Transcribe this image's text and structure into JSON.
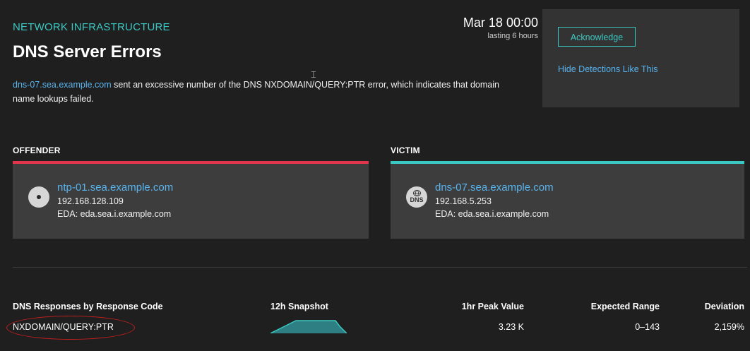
{
  "detection": {
    "category": "NETWORK INFRASTRUCTURE",
    "title": "DNS Server Errors",
    "description_link": "dns-07.sea.example.com",
    "description_text": " sent an excessive number of the DNS NXDOMAIN/QUERY:PTR error, which indicates that domain name lookups failed.",
    "date": "Mar 18 00:00",
    "lasting": "lasting 6 hours"
  },
  "actions": {
    "acknowledge_label": "Acknowledge",
    "hide_label": "Hide Detections Like This"
  },
  "offender": {
    "label": "OFFENDER",
    "name": "ntp-01.sea.example.com",
    "ip": "192.168.128.109",
    "eda": "EDA: eda.sea.i.example.com",
    "icon": "device-icon",
    "accent": "#e0354b"
  },
  "victim": {
    "label": "VICTIM",
    "name": "dns-07.sea.example.com",
    "ip": "192.168.5.253",
    "eda": "EDA: eda.sea.i.example.com",
    "icon": "dns-server-icon",
    "icon_text": "DNS",
    "accent": "#3cc8c2"
  },
  "metrics": {
    "headers": {
      "metric": "DNS Responses by Response Code",
      "snapshot": "12h Snapshot",
      "peak": "1hr Peak Value",
      "expected": "Expected Range",
      "deviation": "Deviation"
    },
    "row": {
      "metric": "NXDOMAIN/QUERY:PTR",
      "peak": "3.23 K",
      "expected": "0–143",
      "deviation": "2,159%"
    }
  },
  "colors": {
    "background": "#1f1f1f",
    "panel": "#333333",
    "card": "#3d3d3d",
    "teal": "#3cc8c2",
    "link": "#59b4ee",
    "offender_red": "#e0354b",
    "annotation": "#c11e1e"
  }
}
